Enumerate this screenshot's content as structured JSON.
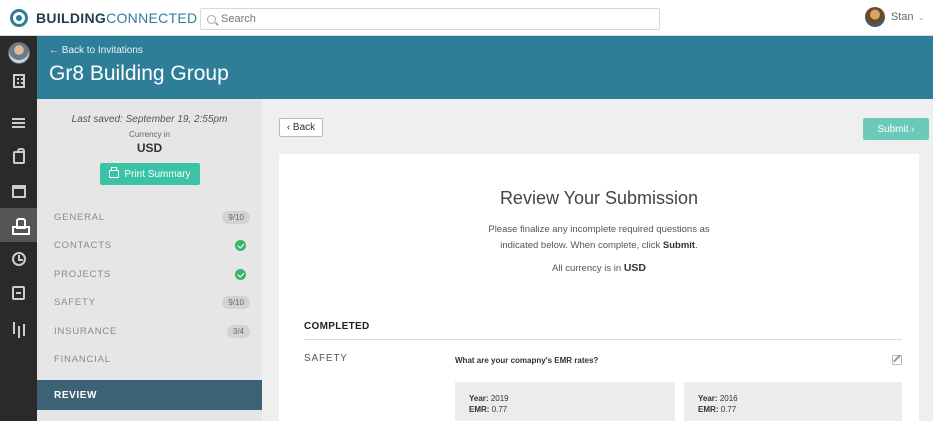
{
  "topbar": {
    "logo_bold": "BUILDING",
    "logo_light": "CONNECTED",
    "search_placeholder": "Search",
    "user_name": "Stan",
    "user_chevron": "⌄"
  },
  "header": {
    "back_link": "← Back to Invitations",
    "company": "Gr8 Building Group",
    "color": "#2f7e99"
  },
  "left_panel": {
    "last_saved": "Last saved: September 19, 2:55pm",
    "currency_label": "Currency in",
    "currency_value": "USD",
    "print_label": "Print Summary",
    "nav": [
      {
        "label": "GENERAL",
        "badge": "9/10"
      },
      {
        "label": "CONTACTS",
        "status": "complete"
      },
      {
        "label": "PROJECTS",
        "status": "complete"
      },
      {
        "label": "SAFETY",
        "badge": "9/10"
      },
      {
        "label": "INSURANCE",
        "badge": "3/4"
      },
      {
        "label": "FINANCIAL"
      }
    ],
    "active_item": "REVIEW"
  },
  "main": {
    "back_label": "‹ Back",
    "submit_label": "Submit ›",
    "title": "Review Your Submission",
    "instructions_1": "Please finalize any incomplete required questions as",
    "instructions_2": "indicated below. When complete, click",
    "instructions_submit": "Submit",
    "instructions_end": ".",
    "currency_text": "All currency is in",
    "currency_value": "USD",
    "completed_heading": "COMPLETED",
    "section_label": "SAFETY",
    "question": "What are your comapny's EMR rates?",
    "emr": [
      {
        "year_label": "Year:",
        "year": "2019",
        "emr_label": "EMR:",
        "emr": "0.77"
      },
      {
        "year_label": "Year:",
        "year": "2016",
        "emr_label": "EMR:",
        "emr": "0.77"
      }
    ]
  },
  "colors": {
    "accent": "#2f7e99",
    "green": "#3bc3a8",
    "review_active": "#3e6275"
  }
}
